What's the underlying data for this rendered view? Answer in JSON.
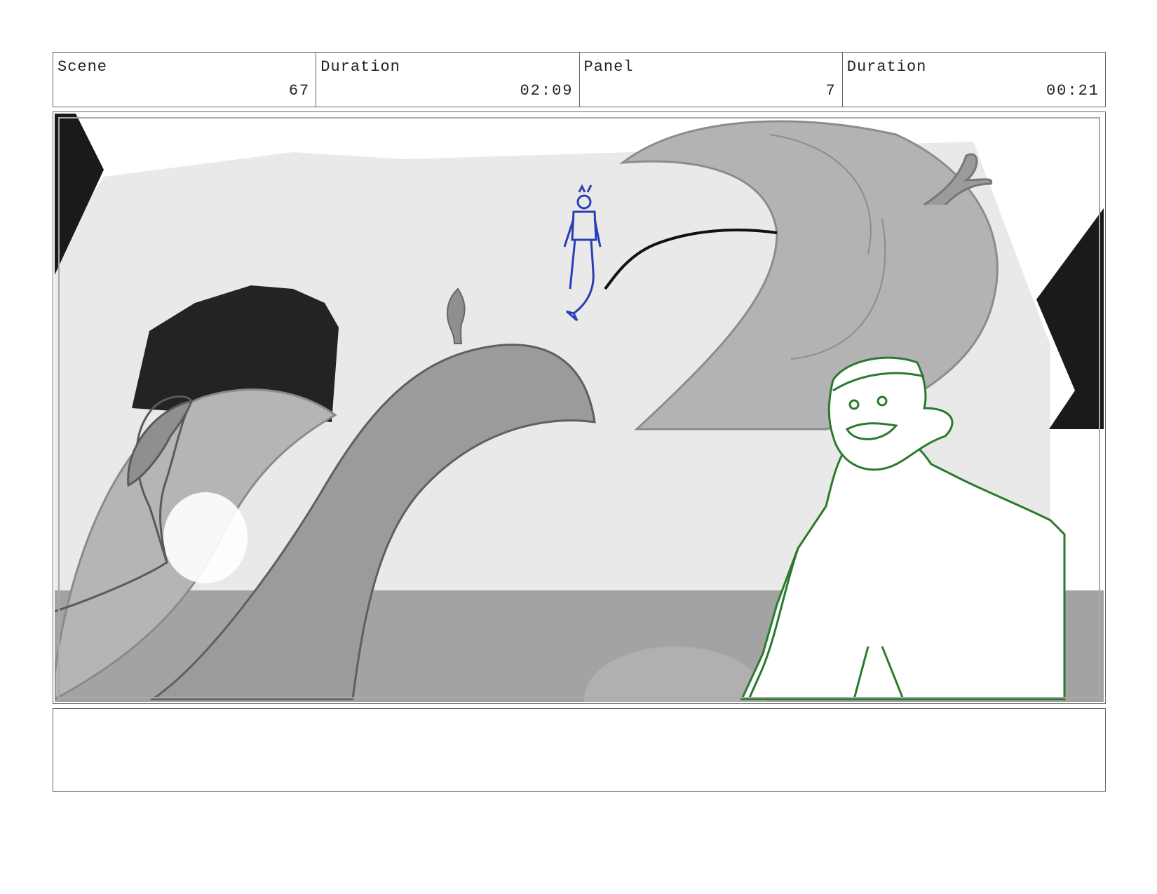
{
  "header": {
    "cells": [
      {
        "label": "Scene",
        "value": "67"
      },
      {
        "label": "Duration",
        "value": "02:09"
      },
      {
        "label": "Panel",
        "value": "7"
      },
      {
        "label": "Duration",
        "value": "00:21"
      }
    ]
  },
  "panel": {
    "description_visible": false,
    "colors": {
      "background": "#ffffff",
      "backdrop": "#e9e9e9",
      "ground": "#a3a3a3",
      "rock_dark": "#1f1f1f",
      "leaf_gray": "#9b9b9b",
      "leaf_light": "#b5b5b5",
      "character_blue": "#2a3fb5",
      "character_green": "#2a7a2e"
    }
  },
  "notes": {
    "text": ""
  }
}
